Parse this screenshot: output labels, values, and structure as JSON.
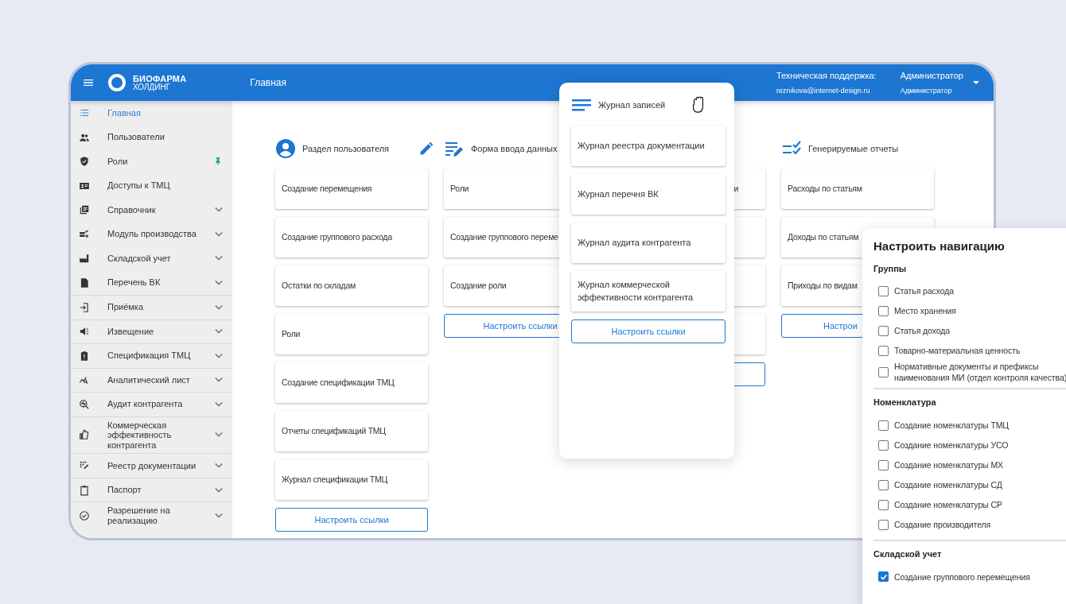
{
  "header": {
    "logo": {
      "line_1": "БИОФАРМА",
      "line_2": "ХОЛДИНГ"
    },
    "title": "Главная",
    "support_label": "Техническая поддержка:",
    "support_email": "reznikova@internet-design.ru",
    "user_name": "Администратор",
    "user_role": "Администратор"
  },
  "sidebar": {
    "items": [
      {
        "label": "Главная",
        "selected": true,
        "expandable": false,
        "pinned": false,
        "separated": false
      },
      {
        "label": "Пользователи",
        "selected": false,
        "expandable": false,
        "pinned": false,
        "separated": false
      },
      {
        "label": "Роли",
        "selected": false,
        "expandable": false,
        "pinned": true,
        "separated": false
      },
      {
        "label": "Доступы к ТМЦ",
        "selected": false,
        "expandable": false,
        "pinned": false,
        "separated": false
      },
      {
        "label": "Справочник",
        "selected": false,
        "expandable": true,
        "pinned": false,
        "separated": false
      },
      {
        "label": "Модуль производства",
        "selected": false,
        "expandable": true,
        "pinned": false,
        "separated": false
      },
      {
        "label": "Складской учет",
        "selected": false,
        "expandable": true,
        "pinned": false,
        "separated": false
      },
      {
        "label": "Перечень ВК",
        "selected": false,
        "expandable": true,
        "pinned": false,
        "separated": false
      },
      {
        "label": "Приёмка",
        "selected": false,
        "expandable": true,
        "pinned": false,
        "separated": true
      },
      {
        "label": "Извещение",
        "selected": false,
        "expandable": true,
        "pinned": false,
        "separated": true
      },
      {
        "label": "Спецификация ТМЦ",
        "selected": false,
        "expandable": true,
        "pinned": false,
        "separated": true
      },
      {
        "label": "Аналитический лист",
        "selected": false,
        "expandable": true,
        "pinned": false,
        "separated": true
      },
      {
        "label": "Аудит контрагента",
        "selected": false,
        "expandable": true,
        "pinned": false,
        "separated": true
      },
      {
        "label": "Коммерческая эффективность контрагента",
        "selected": false,
        "expandable": true,
        "pinned": false,
        "separated": true
      },
      {
        "label": "Реестр документации",
        "selected": false,
        "expandable": true,
        "pinned": false,
        "separated": true
      },
      {
        "label": "Паспорт",
        "selected": false,
        "expandable": true,
        "pinned": false,
        "separated": true
      },
      {
        "label": "Разрешение на реализацию",
        "selected": false,
        "expandable": true,
        "pinned": false,
        "separated": true
      }
    ]
  },
  "columns": [
    {
      "title": "Раздел пользователя",
      "editable": true,
      "items": [
        {
          "kind": "card",
          "label": "Создание перемещения"
        },
        {
          "kind": "card",
          "label": "Создание группового расхода"
        },
        {
          "kind": "card",
          "label": "Остатки по складам"
        },
        {
          "kind": "card",
          "label": "Роли"
        },
        {
          "kind": "card",
          "label": "Создание спецификации ТМЦ"
        },
        {
          "kind": "card",
          "label": "Отчеты спецификаций ТМЦ"
        },
        {
          "kind": "card",
          "label": "Журнал спецификации ТМЦ"
        }
      ],
      "button": {
        "kind": "button",
        "label": "Настроить ссылки"
      }
    },
    {
      "title": "Форма ввода данных",
      "editable": false,
      "items": [
        {
          "kind": "card",
          "label": "Роли"
        },
        {
          "kind": "card",
          "label": "Создание группового переме"
        },
        {
          "kind": "card",
          "label": "Создание роли"
        }
      ],
      "button": {
        "kind": "button",
        "label": "Настроить ссылки"
      }
    },
    {
      "editable": false,
      "items": [
        {
          "kind": "card",
          "label": "и"
        },
        {
          "kind": "covered"
        },
        {
          "kind": "covered"
        },
        {
          "kind": "covered"
        }
      ],
      "button": {
        "kind": "covered"
      }
    },
    {
      "title": "Генерируемые отчеты",
      "editable": false,
      "items": [
        {
          "kind": "card",
          "label": "Расходы по статьям"
        },
        {
          "kind": "card",
          "label": "Доходы по статьям"
        },
        {
          "kind": "card",
          "label": "Приходы по видам"
        }
      ],
      "button": {
        "kind": "button",
        "label": "Настрои"
      }
    }
  ],
  "journal_popup": {
    "title": "Журнал записей",
    "items": [
      "Журнал реестра документации",
      "Журнал перечня ВК",
      "Журнал аудита контрагента",
      "Журнал коммерческой эффективности контрагента"
    ],
    "button": "Настроить ссылки"
  },
  "navigation_settings": {
    "title": "Настроить навигацию",
    "sections": [
      {
        "title": "Группы",
        "items": [
          {
            "label": "Статья расхода",
            "checked": false
          },
          {
            "label": "Место хранения",
            "checked": false
          },
          {
            "label": "Статья дохода",
            "checked": false
          },
          {
            "label": "Товарно-материальная ценность",
            "checked": false
          },
          {
            "label": "Нормативные документы и префиксы наименования МИ (отдел контроля качества)",
            "checked": false
          }
        ]
      },
      {
        "title": "Номенклатура",
        "items": [
          {
            "label": "Создание номенклатуры ТМЦ",
            "checked": false
          },
          {
            "label": "Создание номенклатуры УСО",
            "checked": false
          },
          {
            "label": "Создание номенклатуры МХ",
            "checked": false
          },
          {
            "label": "Создание номенклатуры СД",
            "checked": false
          },
          {
            "label": "Создание номенклатуры СР",
            "checked": false
          },
          {
            "label": "Создание производителя",
            "checked": false
          }
        ]
      },
      {
        "title": "Складской учет",
        "items": [
          {
            "label": "Создание группового перемещения",
            "checked": true
          }
        ]
      }
    ]
  }
}
